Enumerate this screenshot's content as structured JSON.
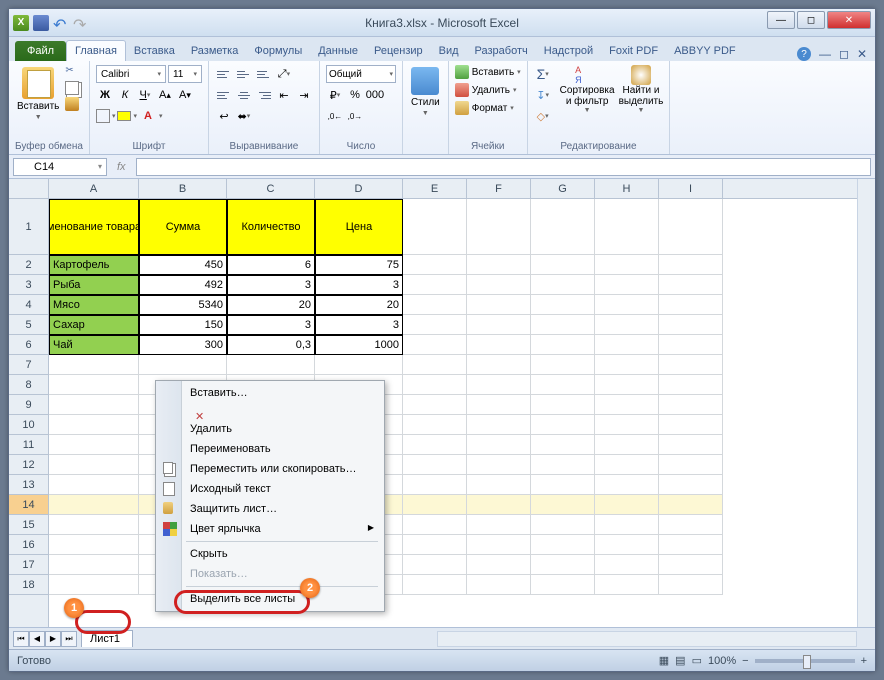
{
  "title": "Книга3.xlsx  -  Microsoft Excel",
  "tabs": {
    "file": "Файл",
    "home": "Главная",
    "insert": "Вставка",
    "layout": "Разметка",
    "formulas": "Формулы",
    "data": "Данные",
    "review": "Рецензир",
    "view": "Вид",
    "developer": "Разработч",
    "addins": "Надстрой",
    "foxit": "Foxit PDF",
    "abbyy": "ABBYY PDF"
  },
  "ribbon": {
    "clipboard": {
      "paste": "Вставить",
      "label": "Буфер обмена"
    },
    "font": {
      "name": "Calibri",
      "size": "11",
      "label": "Шрифт"
    },
    "align": {
      "label": "Выравнивание"
    },
    "number": {
      "format": "Общий",
      "label": "Число"
    },
    "styles": {
      "btn": "Стили",
      "label": ""
    },
    "cells": {
      "insert": "Вставить",
      "delete": "Удалить",
      "format": "Формат",
      "label": "Ячейки"
    },
    "editing": {
      "sort": "Сортировка",
      "sort2": "и фильтр",
      "find": "Найти и",
      "find2": "выделить",
      "label": "Редактирование"
    }
  },
  "namebox": "C14",
  "columns": [
    "A",
    "B",
    "C",
    "D",
    "E",
    "F",
    "G",
    "H",
    "I"
  ],
  "headers": [
    "менование товара",
    "Сумма",
    "Количество",
    "Цена"
  ],
  "rows": [
    {
      "p": "Картофель",
      "s": "450",
      "q": "6",
      "c": "75"
    },
    {
      "p": "Рыба",
      "s": "492",
      "q": "3",
      "c": "3"
    },
    {
      "p": "Мясо",
      "s": "5340",
      "q": "20",
      "c": "20"
    },
    {
      "p": "Сахар",
      "s": "150",
      "q": "3",
      "c": "3"
    },
    {
      "p": "Чай",
      "s": "300",
      "q": "0,3",
      "c": "1000"
    }
  ],
  "sheettab": "Лист1",
  "status": "Готово",
  "zoom": "100%",
  "ctx": {
    "insert": "Вставить…",
    "delete": "Удалить",
    "rename": "Переименовать",
    "move": "Переместить или скопировать…",
    "source": "Исходный текст",
    "protect": "Защитить лист…",
    "tabcolor": "Цвет ярлычка",
    "hide": "Скрыть",
    "show": "Показать…",
    "selectall": "Выделить все листы"
  }
}
